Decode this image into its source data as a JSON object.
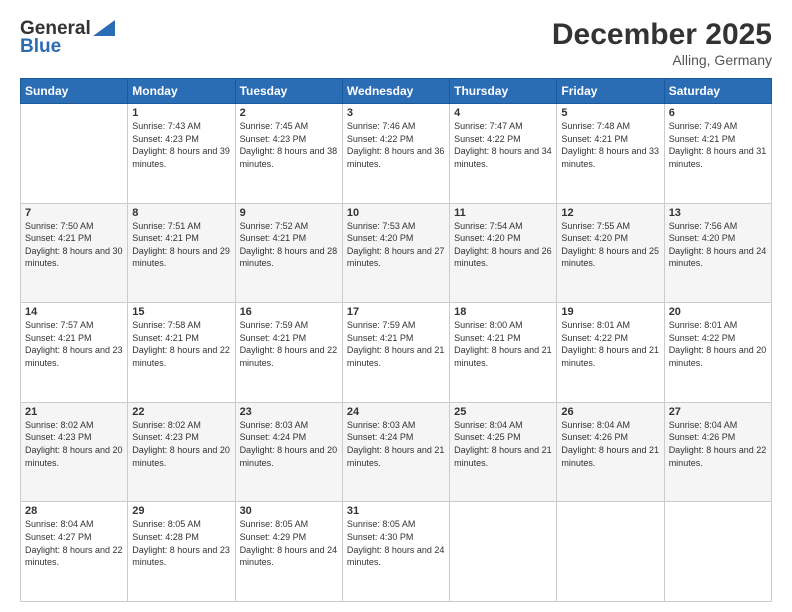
{
  "logo": {
    "line1": "General",
    "line2": "Blue"
  },
  "header": {
    "month": "December 2025",
    "location": "Alling, Germany"
  },
  "days_header": [
    "Sunday",
    "Monday",
    "Tuesday",
    "Wednesday",
    "Thursday",
    "Friday",
    "Saturday"
  ],
  "weeks": [
    [
      {
        "day": "",
        "sunrise": "",
        "sunset": "",
        "daylight": ""
      },
      {
        "day": "1",
        "sunrise": "Sunrise: 7:43 AM",
        "sunset": "Sunset: 4:23 PM",
        "daylight": "Daylight: 8 hours and 39 minutes."
      },
      {
        "day": "2",
        "sunrise": "Sunrise: 7:45 AM",
        "sunset": "Sunset: 4:23 PM",
        "daylight": "Daylight: 8 hours and 38 minutes."
      },
      {
        "day": "3",
        "sunrise": "Sunrise: 7:46 AM",
        "sunset": "Sunset: 4:22 PM",
        "daylight": "Daylight: 8 hours and 36 minutes."
      },
      {
        "day": "4",
        "sunrise": "Sunrise: 7:47 AM",
        "sunset": "Sunset: 4:22 PM",
        "daylight": "Daylight: 8 hours and 34 minutes."
      },
      {
        "day": "5",
        "sunrise": "Sunrise: 7:48 AM",
        "sunset": "Sunset: 4:21 PM",
        "daylight": "Daylight: 8 hours and 33 minutes."
      },
      {
        "day": "6",
        "sunrise": "Sunrise: 7:49 AM",
        "sunset": "Sunset: 4:21 PM",
        "daylight": "Daylight: 8 hours and 31 minutes."
      }
    ],
    [
      {
        "day": "7",
        "sunrise": "Sunrise: 7:50 AM",
        "sunset": "Sunset: 4:21 PM",
        "daylight": "Daylight: 8 hours and 30 minutes."
      },
      {
        "day": "8",
        "sunrise": "Sunrise: 7:51 AM",
        "sunset": "Sunset: 4:21 PM",
        "daylight": "Daylight: 8 hours and 29 minutes."
      },
      {
        "day": "9",
        "sunrise": "Sunrise: 7:52 AM",
        "sunset": "Sunset: 4:21 PM",
        "daylight": "Daylight: 8 hours and 28 minutes."
      },
      {
        "day": "10",
        "sunrise": "Sunrise: 7:53 AM",
        "sunset": "Sunset: 4:20 PM",
        "daylight": "Daylight: 8 hours and 27 minutes."
      },
      {
        "day": "11",
        "sunrise": "Sunrise: 7:54 AM",
        "sunset": "Sunset: 4:20 PM",
        "daylight": "Daylight: 8 hours and 26 minutes."
      },
      {
        "day": "12",
        "sunrise": "Sunrise: 7:55 AM",
        "sunset": "Sunset: 4:20 PM",
        "daylight": "Daylight: 8 hours and 25 minutes."
      },
      {
        "day": "13",
        "sunrise": "Sunrise: 7:56 AM",
        "sunset": "Sunset: 4:20 PM",
        "daylight": "Daylight: 8 hours and 24 minutes."
      }
    ],
    [
      {
        "day": "14",
        "sunrise": "Sunrise: 7:57 AM",
        "sunset": "Sunset: 4:21 PM",
        "daylight": "Daylight: 8 hours and 23 minutes."
      },
      {
        "day": "15",
        "sunrise": "Sunrise: 7:58 AM",
        "sunset": "Sunset: 4:21 PM",
        "daylight": "Daylight: 8 hours and 22 minutes."
      },
      {
        "day": "16",
        "sunrise": "Sunrise: 7:59 AM",
        "sunset": "Sunset: 4:21 PM",
        "daylight": "Daylight: 8 hours and 22 minutes."
      },
      {
        "day": "17",
        "sunrise": "Sunrise: 7:59 AM",
        "sunset": "Sunset: 4:21 PM",
        "daylight": "Daylight: 8 hours and 21 minutes."
      },
      {
        "day": "18",
        "sunrise": "Sunrise: 8:00 AM",
        "sunset": "Sunset: 4:21 PM",
        "daylight": "Daylight: 8 hours and 21 minutes."
      },
      {
        "day": "19",
        "sunrise": "Sunrise: 8:01 AM",
        "sunset": "Sunset: 4:22 PM",
        "daylight": "Daylight: 8 hours and 21 minutes."
      },
      {
        "day": "20",
        "sunrise": "Sunrise: 8:01 AM",
        "sunset": "Sunset: 4:22 PM",
        "daylight": "Daylight: 8 hours and 20 minutes."
      }
    ],
    [
      {
        "day": "21",
        "sunrise": "Sunrise: 8:02 AM",
        "sunset": "Sunset: 4:23 PM",
        "daylight": "Daylight: 8 hours and 20 minutes."
      },
      {
        "day": "22",
        "sunrise": "Sunrise: 8:02 AM",
        "sunset": "Sunset: 4:23 PM",
        "daylight": "Daylight: 8 hours and 20 minutes."
      },
      {
        "day": "23",
        "sunrise": "Sunrise: 8:03 AM",
        "sunset": "Sunset: 4:24 PM",
        "daylight": "Daylight: 8 hours and 20 minutes."
      },
      {
        "day": "24",
        "sunrise": "Sunrise: 8:03 AM",
        "sunset": "Sunset: 4:24 PM",
        "daylight": "Daylight: 8 hours and 21 minutes."
      },
      {
        "day": "25",
        "sunrise": "Sunrise: 8:04 AM",
        "sunset": "Sunset: 4:25 PM",
        "daylight": "Daylight: 8 hours and 21 minutes."
      },
      {
        "day": "26",
        "sunrise": "Sunrise: 8:04 AM",
        "sunset": "Sunset: 4:26 PM",
        "daylight": "Daylight: 8 hours and 21 minutes."
      },
      {
        "day": "27",
        "sunrise": "Sunrise: 8:04 AM",
        "sunset": "Sunset: 4:26 PM",
        "daylight": "Daylight: 8 hours and 22 minutes."
      }
    ],
    [
      {
        "day": "28",
        "sunrise": "Sunrise: 8:04 AM",
        "sunset": "Sunset: 4:27 PM",
        "daylight": "Daylight: 8 hours and 22 minutes."
      },
      {
        "day": "29",
        "sunrise": "Sunrise: 8:05 AM",
        "sunset": "Sunset: 4:28 PM",
        "daylight": "Daylight: 8 hours and 23 minutes."
      },
      {
        "day": "30",
        "sunrise": "Sunrise: 8:05 AM",
        "sunset": "Sunset: 4:29 PM",
        "daylight": "Daylight: 8 hours and 24 minutes."
      },
      {
        "day": "31",
        "sunrise": "Sunrise: 8:05 AM",
        "sunset": "Sunset: 4:30 PM",
        "daylight": "Daylight: 8 hours and 24 minutes."
      },
      {
        "day": "",
        "sunrise": "",
        "sunset": "",
        "daylight": ""
      },
      {
        "day": "",
        "sunrise": "",
        "sunset": "",
        "daylight": ""
      },
      {
        "day": "",
        "sunrise": "",
        "sunset": "",
        "daylight": ""
      }
    ]
  ]
}
